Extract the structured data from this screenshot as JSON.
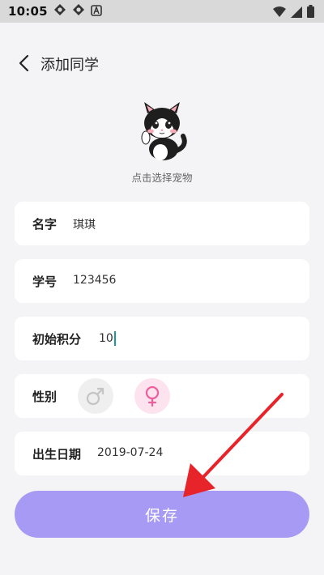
{
  "status_bar": {
    "time": "10:05",
    "left_icons": [
      "gear-icon",
      "gear-icon",
      "text-icon"
    ],
    "right_icons": [
      "wifi-icon",
      "signal-icon",
      "battery-icon"
    ]
  },
  "header": {
    "title": "添加同学",
    "back_icon": "chevron-left-icon"
  },
  "pet": {
    "hint": "点击选择宠物"
  },
  "form": {
    "name_label": "名字",
    "name_value": "琪琪",
    "student_id_label": "学号",
    "student_id_value": "123456",
    "initial_points_label": "初始积分",
    "initial_points_value": "10",
    "gender_label": "性别",
    "gender_options": [
      "male-icon",
      "female-icon"
    ],
    "gender_selected": "female",
    "birthday_label": "出生日期",
    "birthday_value": "2019-07-24"
  },
  "save_button": {
    "label": "保存"
  },
  "colors": {
    "accent": "#a79af4",
    "female": "#ec5f9c",
    "male": "#c4c4c4",
    "annotation": "#e8242b"
  }
}
